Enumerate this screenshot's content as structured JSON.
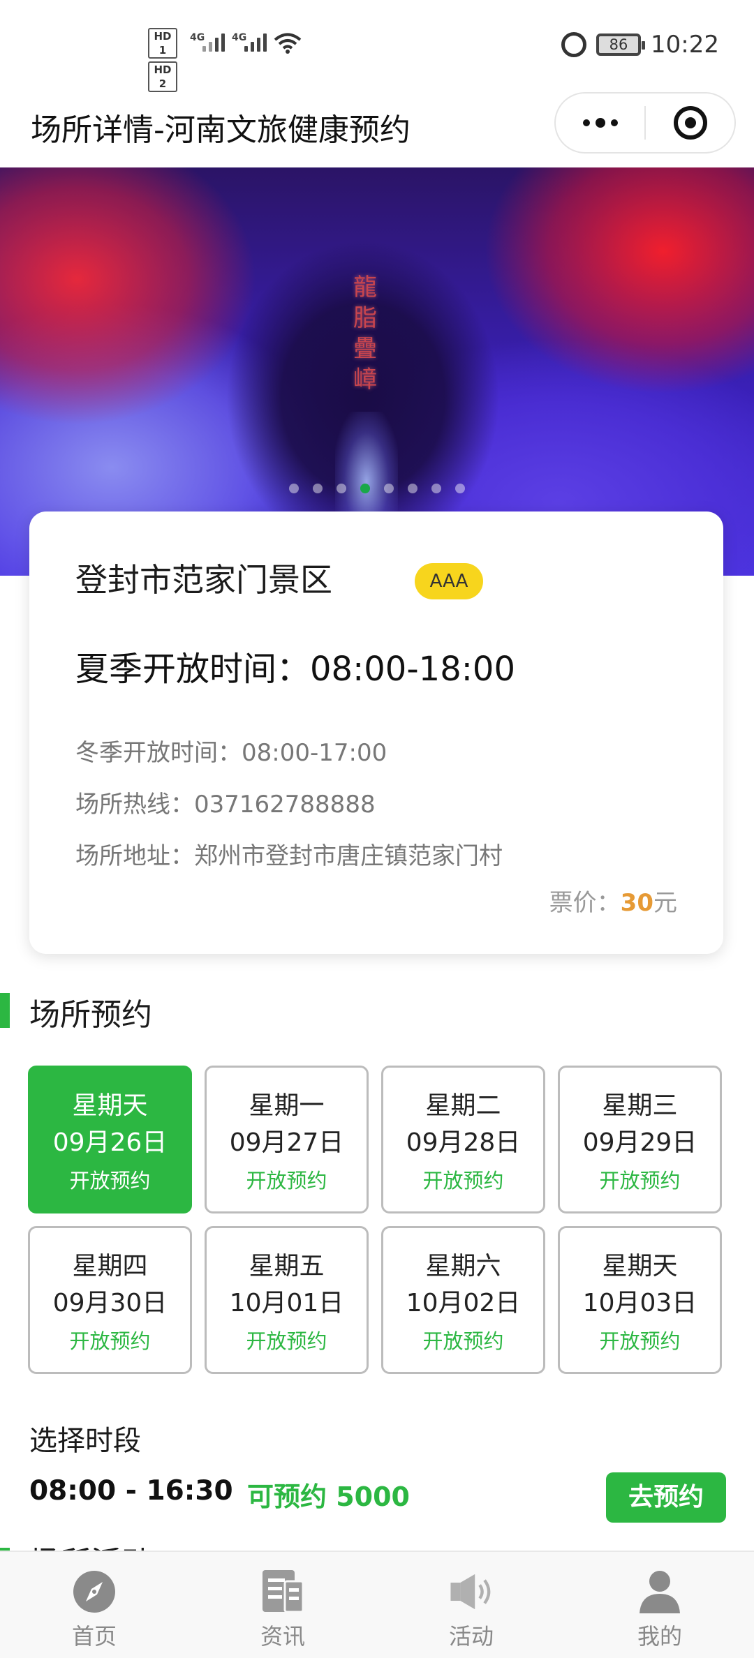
{
  "status_bar": {
    "hd1": "HD 1",
    "hd2": "HD 2",
    "net1": "4G",
    "net2": "4G",
    "battery": "86",
    "time": "10:22"
  },
  "nav": {
    "title": "场所详情-河南文旅健康预约"
  },
  "banner": {
    "carved_text": "龍脂疊嶂",
    "slide_count": 8,
    "active_slide": 4
  },
  "venue": {
    "name": "登封市范家门景区",
    "badge": "AAA",
    "summer_hours": "夏季开放时间：08:00-18:00",
    "winter_hours": "冬季开放时间：08:00-17:00",
    "hotline": "场所热线：037162788888",
    "address": "场所地址：郑州市登封市唐庄镇范家门村",
    "price_label": "票价：",
    "price_amount": "30",
    "price_unit": "元"
  },
  "booking": {
    "section_title": "场所预约",
    "dates": [
      {
        "weekday": "星期天",
        "date": "09月26日",
        "status": "开放预约",
        "selected": true
      },
      {
        "weekday": "星期一",
        "date": "09月27日",
        "status": "开放预约",
        "selected": false
      },
      {
        "weekday": "星期二",
        "date": "09月28日",
        "status": "开放预约",
        "selected": false
      },
      {
        "weekday": "星期三",
        "date": "09月29日",
        "status": "开放预约",
        "selected": false
      },
      {
        "weekday": "星期四",
        "date": "09月30日",
        "status": "开放预约",
        "selected": false
      },
      {
        "weekday": "星期五",
        "date": "10月01日",
        "status": "开放预约",
        "selected": false
      },
      {
        "weekday": "星期六",
        "date": "10月02日",
        "status": "开放预约",
        "selected": false
      },
      {
        "weekday": "星期天",
        "date": "10月03日",
        "status": "开放预约",
        "selected": false
      }
    ],
    "slot_label": "选择时段",
    "slot_time": "08:00 - 16:30",
    "slot_available": "可预约 5000",
    "book_button": "去预约"
  },
  "next_section": {
    "title": "场所活动"
  },
  "tab_bar": {
    "tabs": [
      {
        "label": "首页",
        "icon": "compass-icon"
      },
      {
        "label": "资讯",
        "icon": "news-icon"
      },
      {
        "label": "活动",
        "icon": "speaker-icon"
      },
      {
        "label": "我的",
        "icon": "user-icon"
      }
    ]
  },
  "colors": {
    "accent_green": "#2cb742",
    "badge_yellow": "#f7d51d",
    "price_orange": "#e69a35"
  }
}
